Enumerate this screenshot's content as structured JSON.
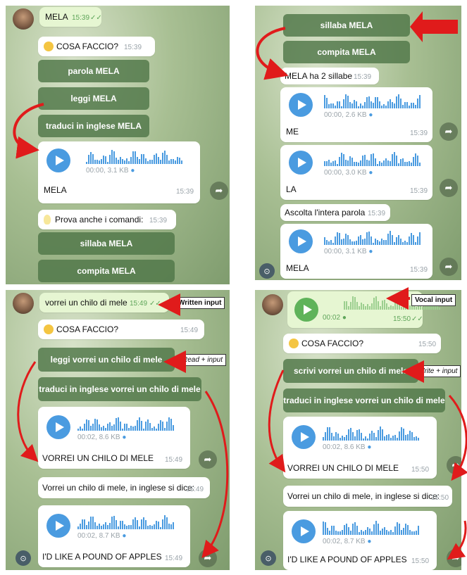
{
  "panels": {
    "tl": {
      "sent_text": "MELA",
      "sent_time": "15:39",
      "question": "COSA FACCIO?",
      "question_time": "15:39",
      "buttons": [
        "parola MELA",
        "leggi MELA",
        "traduci in inglese MELA"
      ],
      "audio": {
        "meta": "00:00, 3.1 KB",
        "caption": "MELA",
        "time": "15:39"
      },
      "hint": "Prova anche i comandi:",
      "hint_time": "15:39",
      "buttons2": [
        "sillaba MELA",
        "compita MELA"
      ]
    },
    "tr": {
      "buttons": [
        "sillaba MELA",
        "compita MELA"
      ],
      "reply": "MELA ha 2 sillabe",
      "reply_time": "15:39",
      "audio1": {
        "meta": "00:00, 2.6 KB",
        "caption": "ME",
        "time": "15:39"
      },
      "audio2": {
        "meta": "00:00, 3.0 KB",
        "caption": "LA",
        "time": "15:39"
      },
      "listen": "Ascolta l'intera parola",
      "listen_time": "15:39",
      "audio3": {
        "meta": "00:00, 3.1 KB",
        "caption": "MELA",
        "time": "15:39"
      }
    },
    "bl": {
      "sent_text": "vorrei un chilo di mele",
      "sent_time": "15:49",
      "callout_written": "Written input",
      "question": "COSA FACCIO?",
      "question_time": "15:49",
      "buttons": [
        "leggi vorrei un chilo di mele",
        "traduci in inglese vorrei un chilo di mele"
      ],
      "callout_read": "Read + input",
      "audio1": {
        "meta": "00:02, 8.6 KB",
        "caption": "VORREI UN CHILO DI MELE",
        "time": "15:49"
      },
      "translate": "Vorrei un chilo di mele, in inglese si dice:",
      "translate_time": "15:49",
      "audio2": {
        "meta": "00:02, 8.7 KB",
        "caption": "I'D LIKE A POUND OF APPLES",
        "time": "15:49"
      }
    },
    "br": {
      "voice_meta": "00:02",
      "voice_time": "15:50",
      "callout_vocal": "Vocal input",
      "question": "COSA FACCIO?",
      "question_time": "15:50",
      "buttons": [
        "scrivi vorrei un chilo di mele",
        "traduci in inglese vorrei un chilo di mele"
      ],
      "callout_write": "Write + input",
      "audio1": {
        "meta": "00:02, 8.6 KB",
        "caption": "VORREI UN CHILO DI MELE",
        "time": "15:50"
      },
      "translate": "Vorrei un chilo di mele, in inglese si dice:",
      "translate_time": "15:50",
      "audio2": {
        "meta": "00:02, 8.7 KB",
        "caption": "I'D LIKE A POUND OF APPLES",
        "time": "15:50"
      }
    }
  },
  "glyphs": {
    "check": "✓✓",
    "share": "➦",
    "clip": "📎"
  },
  "colors": {
    "keyboard_button": "#4f7648",
    "play_blue": "#4a9be0",
    "arrow_red": "#e01b1b",
    "sent_bubble": "#e6f6d2"
  }
}
